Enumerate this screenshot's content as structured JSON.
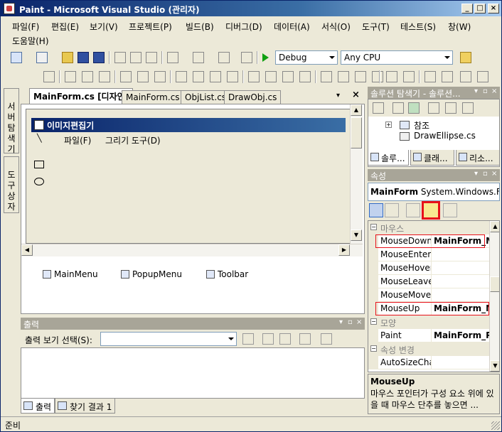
{
  "window": {
    "title": "Paint - Microsoft Visual Studio (관리자)",
    "controls": {
      "minimize": "_",
      "maximize": "□",
      "close": "×"
    }
  },
  "menubar": {
    "row1": [
      "파일(F)",
      "편집(E)",
      "보기(V)",
      "프로젝트(P)",
      "빌드(B)",
      "디버그(D)",
      "데이터(A)",
      "서식(O)",
      "도구(T)",
      "테스트(S)",
      "창(W)"
    ],
    "row2": [
      "도움말(H)"
    ]
  },
  "toolbar": {
    "config_combo": "Debug",
    "platform_combo": "Any CPU"
  },
  "side_tabs": {
    "server_explorer": "서버 탐색기",
    "toolbox": "도구 상자"
  },
  "document": {
    "tabs": [
      "MainForm.cs [디자인]",
      "MainForm.cs",
      "ObjList.cs",
      "DrawObj.cs"
    ],
    "active_tab": 0,
    "form_title": "이미지편집기",
    "form_menu": [
      "파일(F)",
      "그리기 도구(D)"
    ],
    "tray": [
      "MainMenu",
      "PopupMenu",
      "Toolbar"
    ]
  },
  "output": {
    "header": "출력",
    "source_label": "출력 보기 선택(S):",
    "tabs": [
      "출력",
      "찾기 결과 1"
    ]
  },
  "solution_explorer": {
    "header": "솔루션 탐색기 - 솔루션...",
    "tree": [
      "참조",
      "DrawEllipse.cs"
    ],
    "tabs": [
      "솔루...",
      "클래...",
      "리소..."
    ]
  },
  "properties": {
    "header": "속성",
    "object_name": "MainForm",
    "object_type": "System.Windows.Fo",
    "rows": [
      {
        "kind": "cat",
        "name": "마우스"
      },
      {
        "kind": "prop",
        "name": "MouseDown",
        "value": "MainForm_Mo",
        "boxed": true
      },
      {
        "kind": "prop",
        "name": "MouseEnter",
        "value": ""
      },
      {
        "kind": "prop",
        "name": "MouseHover",
        "value": ""
      },
      {
        "kind": "prop",
        "name": "MouseLeave",
        "value": ""
      },
      {
        "kind": "prop",
        "name": "MouseMove",
        "value": ""
      },
      {
        "kind": "prop",
        "name": "MouseUp",
        "value": "MainForm_Mo",
        "boxed": true
      },
      {
        "kind": "cat",
        "name": "모양"
      },
      {
        "kind": "prop",
        "name": "Paint",
        "value": "MainForm_Pa"
      },
      {
        "kind": "cat",
        "name": "속성 변경"
      },
      {
        "kind": "prop",
        "name": "AutoSizeCha",
        "value": ""
      }
    ],
    "description": {
      "title": "MouseUp",
      "text": "마우스 포인터가 구성 요소 위에 있을 때 마우스 단추를 놓으면 ..."
    }
  },
  "statusbar": {
    "text": "준비"
  }
}
